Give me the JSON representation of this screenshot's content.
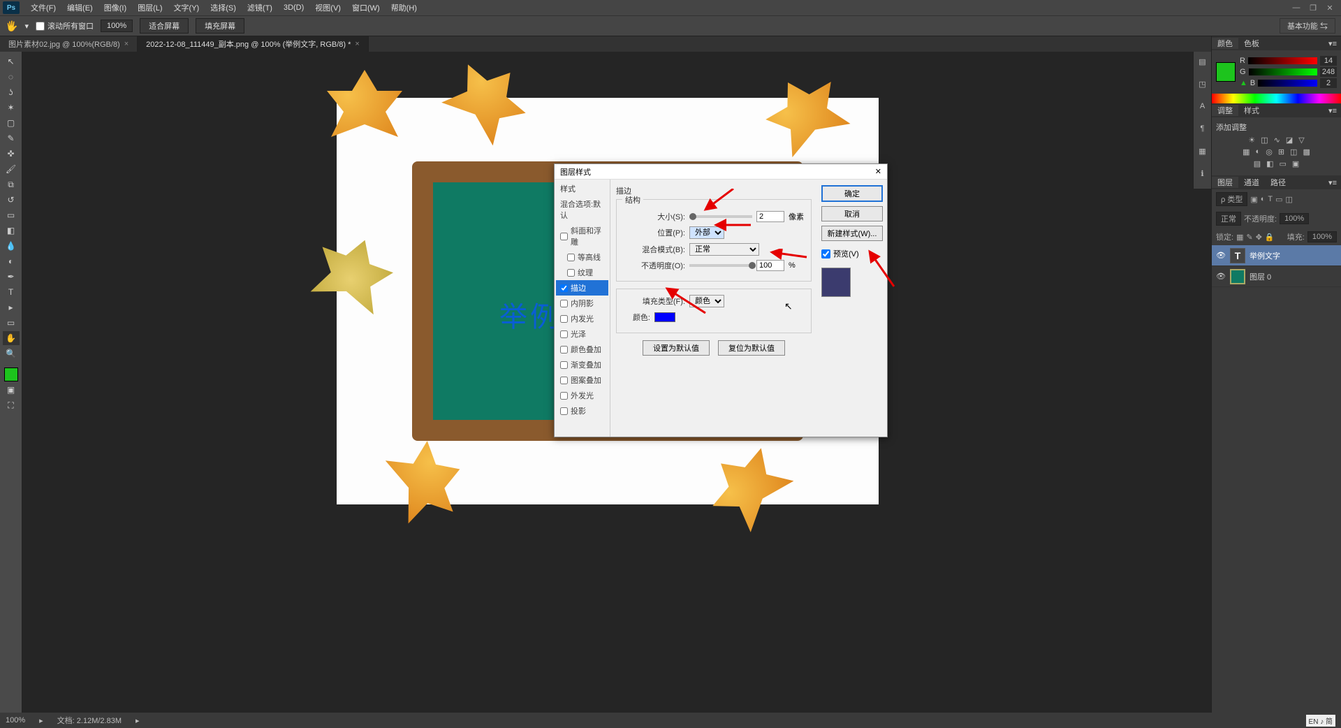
{
  "menubar": {
    "items": [
      "文件(F)",
      "编辑(E)",
      "图像(I)",
      "图层(L)",
      "文字(Y)",
      "选择(S)",
      "滤镜(T)",
      "3D(D)",
      "视图(V)",
      "窗口(W)",
      "帮助(H)"
    ]
  },
  "optionsbar": {
    "scroll_all_windows": "滚动所有窗口",
    "zoom": "100%",
    "fit_screen": "适合屏幕",
    "fill_screen": "填充屏幕",
    "workspace": "基本功能"
  },
  "doctabs": [
    {
      "label": "图片素材02.jpg @ 100%(RGB/8)",
      "active": false
    },
    {
      "label": "2022-12-08_111449_副本.png @ 100% (举例文字, RGB/8) *",
      "active": true
    }
  ],
  "canvas": {
    "sample_text": "举例文字"
  },
  "color_panel": {
    "tabs": [
      "颜色",
      "色板"
    ],
    "r": {
      "label": "R",
      "value": "14"
    },
    "g": {
      "label": "G",
      "value": "248"
    },
    "b": {
      "label": "B",
      "value": "2"
    }
  },
  "adjust_panel": {
    "tabs": [
      "调整",
      "样式"
    ],
    "add_label": "添加调整"
  },
  "layers_panel": {
    "tabs": [
      "图层",
      "通道",
      "路径"
    ],
    "kind": "ρ 类型",
    "blend_mode": "正常",
    "opacity_label": "不透明度:",
    "opacity_value": "100%",
    "lock_label": "锁定:",
    "fill_label": "填充:",
    "fill_value": "100%",
    "layers": [
      {
        "name": "举例文字",
        "type": "text"
      },
      {
        "name": "图层 0",
        "type": "image"
      }
    ]
  },
  "statusbar": {
    "zoom": "100%",
    "docinfo": "文档: 2.12M/2.83M",
    "ime": "EN ♪ 简"
  },
  "dialog": {
    "title": "图层样式",
    "style_section_header": "样式",
    "blending_options": "混合选项:默认",
    "styles": [
      {
        "label": "斜面和浮雕",
        "checked": false
      },
      {
        "label": "等高线",
        "checked": false,
        "indent": true
      },
      {
        "label": "纹理",
        "checked": false,
        "indent": true
      },
      {
        "label": "描边",
        "checked": true,
        "active": true
      },
      {
        "label": "内阴影",
        "checked": false
      },
      {
        "label": "内发光",
        "checked": false
      },
      {
        "label": "光泽",
        "checked": false
      },
      {
        "label": "颜色叠加",
        "checked": false
      },
      {
        "label": "渐变叠加",
        "checked": false
      },
      {
        "label": "图案叠加",
        "checked": false
      },
      {
        "label": "外发光",
        "checked": false
      },
      {
        "label": "投影",
        "checked": false
      }
    ],
    "stroke": {
      "section": "描边",
      "structure": "结构",
      "size_label": "大小(S):",
      "size_value": "2",
      "size_unit": "像素",
      "position_label": "位置(P):",
      "position_value": "外部",
      "blendmode_label": "混合模式(B):",
      "blendmode_value": "正常",
      "opacity_label": "不透明度(O):",
      "opacity_value": "100",
      "opacity_unit": "%",
      "filltype_label": "填充类型(F):",
      "filltype_value": "颜色",
      "color_label": "颜色:",
      "set_default": "设置为默认值",
      "reset_default": "复位为默认值"
    },
    "buttons": {
      "ok": "确定",
      "cancel": "取消",
      "new_style": "新建样式(W)...",
      "preview": "预览(V)"
    }
  }
}
